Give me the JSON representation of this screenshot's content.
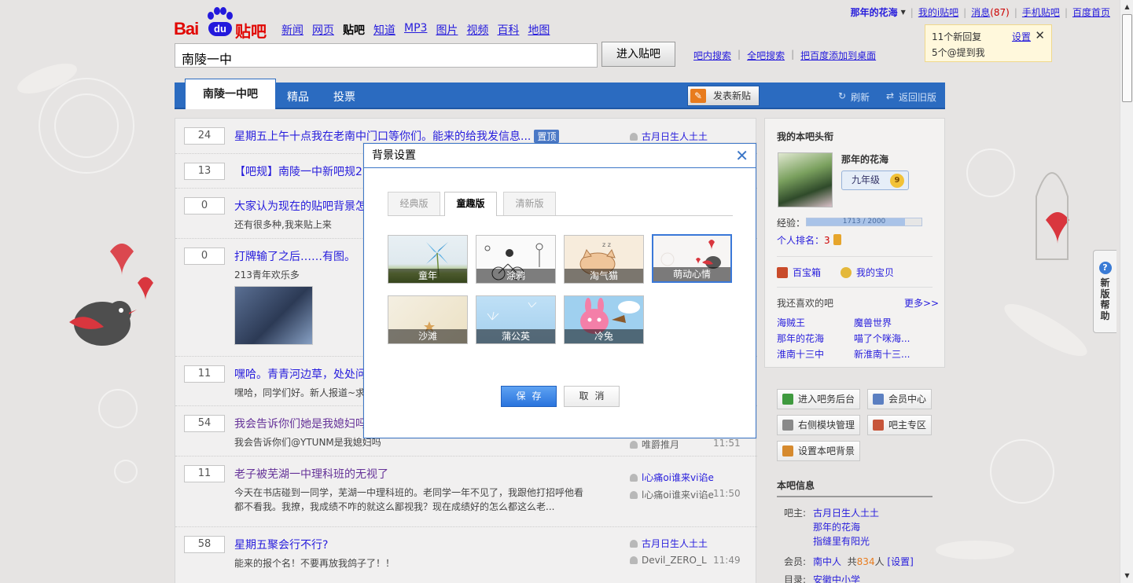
{
  "header": {
    "logo_text_bai": "Bai",
    "logo_text_du": "du",
    "logo_text_tieba": "贴吧",
    "nav": [
      "新闻",
      "网页",
      "贴吧",
      "知道",
      "MP3",
      "图片",
      "视频",
      "百科",
      "地图"
    ],
    "nav_active_index": 2,
    "search_value": "南陵一中",
    "search_button": "进入贴吧",
    "sublinks": [
      "吧内搜索",
      "全吧搜索",
      "把百度添加到桌面"
    ]
  },
  "userbar": {
    "username": "那年的花海",
    "links": [
      "我的i贴吧",
      "消息",
      "手机贴吧",
      "百度首页"
    ],
    "message_count": "(87)"
  },
  "notify": {
    "line1": "11个新回复",
    "line2": "5个@提到我",
    "settings": "设置",
    "close": "✕"
  },
  "tabbar": {
    "main_tab": "南陵一中吧",
    "tabs": [
      "精品",
      "投票"
    ],
    "post_button": "发表新贴",
    "refresh": "刷新",
    "old_version": "返回旧版"
  },
  "threads": [
    {
      "count": "24",
      "title": "星期五上午十点我在老南中门口等你们。能来的给我发信息...",
      "tag": "置顶",
      "excerpt": "",
      "author1": "古月日生人土土",
      "author2": "",
      "time": ""
    },
    {
      "count": "13",
      "title": "【吧规】南陵一中新吧规2",
      "tag": "",
      "excerpt": "",
      "author1": "",
      "author2": "",
      "time": ""
    },
    {
      "count": "0",
      "title": "大家认为现在的贴吧背景怎",
      "tag": "",
      "excerpt": "还有很多种,我来贴上来",
      "author1": "",
      "author2": "",
      "time": ""
    },
    {
      "count": "0",
      "title": "打牌输了之后……有图。",
      "tag": "",
      "excerpt": "213青年欢乐多",
      "author1": "",
      "author2": "",
      "time": ""
    },
    {
      "count": "11",
      "title": "嘿哈。青青河边草，处处问",
      "tag": "",
      "excerpt": "嘿哈，同学们好。新人报道~求",
      "author1": "",
      "author2": "",
      "time": ""
    },
    {
      "count": "54",
      "title": "我会告诉你们她是我媳妇吗",
      "tag": "",
      "excerpt": "我会告诉你们@YTUNM是我媳妇吗",
      "author1": "",
      "author2": "唯爵推月",
      "time": "11:51"
    },
    {
      "count": "11",
      "title": "老子被芜湖一中理科班的无视了",
      "tag": "",
      "excerpt": "今天在书店碰到一同学，芜湖一中理科班的。老同学一年不见了，我跟他打招呼他看",
      "excerpt2": "都不看我。我撩，我成绩不咋的就这么鄙视我？现在成绩好的怎么都这么老...",
      "author1": "l心痛oi谁来vi谄e",
      "author2": "l心痛oi谁来vi谄e",
      "time": "11:50"
    },
    {
      "count": "58",
      "title": "星期五聚会行不行?",
      "tag": "",
      "excerpt": "能来的报个名！不要再放我鸽子了！！",
      "author1": "古月日生人土土",
      "author2": "Devil_ZERO_L",
      "time": "11:49"
    }
  ],
  "sidebar": {
    "heading": "我的本吧头衔",
    "username": "那年的花海",
    "grade": "九年级",
    "level": "9",
    "exp_label": "经验：",
    "exp_value": "1713 / 2000",
    "exp_fraction": 0.8565,
    "rank_label": "个人排名：",
    "rank_value": "3",
    "treasure_box": "百宝箱",
    "my_treasure": "我的宝贝",
    "like_heading": "我还喜欢的吧",
    "like_more": "更多>>",
    "favorites": [
      "海贼王",
      "魔兽世界",
      "那年的花海",
      "喵了个咪海...",
      "淮南十三中",
      "新淮南十三..."
    ]
  },
  "admin": {
    "buttons": [
      "进入吧务后台",
      "会员中心",
      "右侧模块管理",
      "吧主专区",
      "设置本吧背景"
    ]
  },
  "info": {
    "heading": "本吧信息",
    "owner_label": "吧主:",
    "owners": [
      "古月日生人土土",
      "那年的花海",
      "指缝里有阳光"
    ],
    "members_label": "会员:",
    "members_name": "南中人",
    "members_total_prefix": "共",
    "members_count": "834",
    "members_suffix": "人",
    "members_set": "[设置]",
    "dir_label": "目录:",
    "dir_value": "安徽中小学"
  },
  "help_tab": {
    "q": "?",
    "text": "新版帮助"
  },
  "modal": {
    "title": "背景设置",
    "close": "✕",
    "tabs": [
      "经典版",
      "童趣版",
      "清新版"
    ],
    "active_tab": 1,
    "skins": [
      "童年",
      "涂鸦",
      "淘气猫",
      "萌动心情",
      "沙滩",
      "蒲公英",
      "冷兔"
    ],
    "selected_skin": 3,
    "save": "保存",
    "cancel": "取消"
  },
  "colors": {
    "accent_blue": "#2b6bc0",
    "link_blue": "#261cdc",
    "brand_red": "#e10602"
  }
}
